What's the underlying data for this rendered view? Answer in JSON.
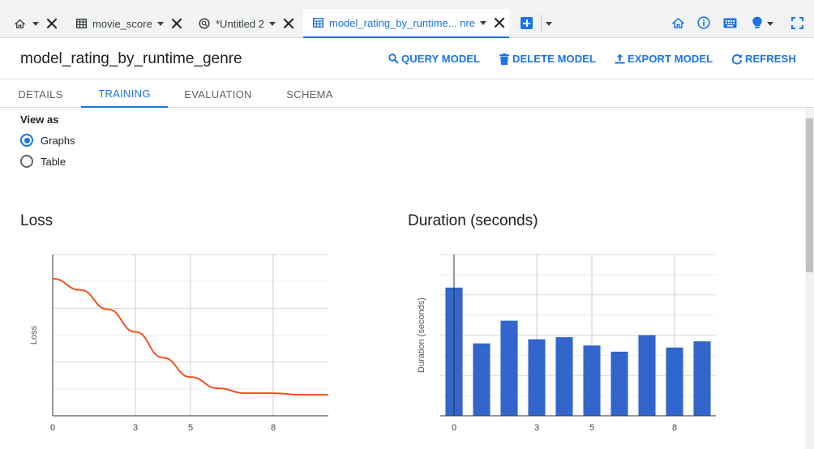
{
  "tabs": [
    {
      "label": "",
      "icon": "home-icon"
    },
    {
      "label": "movie_score",
      "icon": "table-icon"
    },
    {
      "label": "*Untitled 2",
      "icon": "query-icon"
    },
    {
      "label": "model_rating_by_runtime... nre",
      "icon": "model-icon",
      "active": true
    }
  ],
  "header": {
    "title": "model_rating_by_runtime_genre",
    "query_label": "QUERY MODEL",
    "delete_label": "DELETE MODEL",
    "export_label": "EXPORT MODEL",
    "refresh_label": "REFRESH"
  },
  "subtabs": [
    "DETAILS",
    "TRAINING",
    "EVALUATION",
    "SCHEMA"
  ],
  "active_subtab": "TRAINING",
  "view_as": {
    "label": "View as",
    "options": [
      "Graphs",
      "Table"
    ],
    "selected": "Graphs"
  },
  "colors": {
    "accent": "#1a73e8",
    "loss_line": "#f4511e",
    "bar": "#3366cc"
  },
  "chart_data": [
    {
      "type": "line",
      "title": "Loss",
      "ylabel": "Loss",
      "xlabel": "",
      "x_ticks": [
        "0",
        "3",
        "5",
        "8"
      ],
      "x": [
        0,
        1,
        2,
        3,
        4,
        5,
        6,
        7,
        8,
        9,
        10
      ],
      "values": [
        0.85,
        0.78,
        0.66,
        0.52,
        0.36,
        0.24,
        0.17,
        0.14,
        0.14,
        0.13,
        0.13
      ],
      "xlim": [
        0,
        10
      ],
      "ylim": [
        0,
        1
      ]
    },
    {
      "type": "bar",
      "title": "Duration (seconds)",
      "ylabel": "Duration (seconds)",
      "xlabel": "",
      "x_ticks": [
        "0",
        "3",
        "5",
        "8"
      ],
      "categories": [
        "0",
        "1",
        "2",
        "3",
        "4",
        "5",
        "6",
        "7",
        "8",
        "9"
      ],
      "values": [
        3.1,
        1.75,
        2.3,
        1.85,
        1.9,
        1.7,
        1.55,
        1.95,
        1.65,
        1.8
      ],
      "ylim": [
        0,
        3.9
      ]
    }
  ]
}
